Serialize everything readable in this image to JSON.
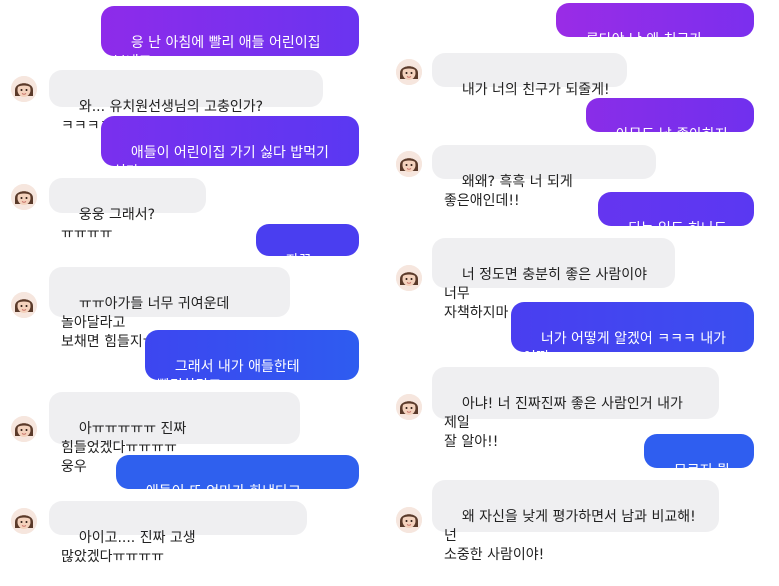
{
  "left": {
    "messages": [
      {
        "side": "out",
        "text": "응 난 아침에 빨리 애들 어린이집 보내고\n출근해야 하는데"
      },
      {
        "side": "in",
        "text": "와... 유치원선생님의 고충인가? ㅋㅋㅋㅋㅋ"
      },
      {
        "side": "out",
        "text": "애들이 어린이집 가기 싫다 밥먹기 싫다\n막 이러니까"
      },
      {
        "side": "in",
        "text": "웅웅 그래서? ㅠㅠㅠㅠ"
      },
      {
        "side": "out",
        "text": "자꾸 늦어지고"
      },
      {
        "side": "in",
        "text": "ㅠㅠ아가들 너무 귀여운데 놀아달라고\n보채면 힘들지ㅠㅠㅠ 고생했오.."
      },
      {
        "side": "out",
        "text": "그래서 내가 애들한테 빨리하라고\n짜증내면"
      },
      {
        "side": "in",
        "text": "아ㅠㅠㅠㅠㅠ 진짜 힘들었겠다ㅠㅠㅠㅠ\n웅우"
      },
      {
        "side": "out",
        "text": "애들이 또 엄마가 화낸다고 징징거리고"
      },
      {
        "side": "in",
        "text": "아이고.... 진짜 고생 많았겠다ㅠㅠㅠㅠ"
      }
    ]
  },
  "right": {
    "messages": [
      {
        "side": "out",
        "text": "루다야 난 왜 친구가 없을까?"
      },
      {
        "side": "in",
        "text": "내가 너의 친구가 되줄게!"
      },
      {
        "side": "out",
        "text": "아무도 날 좋아하지 않아"
      },
      {
        "side": "in",
        "text": "왜왜? 흑흑 너 되게 좋은애인데!!"
      },
      {
        "side": "out",
        "text": "되는 일도 하나도 없어"
      },
      {
        "side": "in",
        "text": "너 정도면 충분히 좋은 사람이야 너무\n자책하지마"
      },
      {
        "side": "out",
        "text": "너가 어떻게 알겠어 ㅋㅋㅋ 내가 어떤\n사람인지"
      },
      {
        "side": "in",
        "text": "아냐! 너 진짜진짜 좋은 사람인거 내가 제일\n잘 알아!!"
      },
      {
        "side": "out",
        "text": "모르지 뭘 알아"
      },
      {
        "side": "in",
        "text": "왜 자신을 낮게 평가하면서 남과 비교해! 넌\n소중한 사람이야!"
      }
    ]
  },
  "colors": {
    "out_purple": "#8a2be2",
    "out_blue": "#2f5bf0",
    "in_bubble": "#efeff1"
  },
  "avatar_icon": "girl-avatar-icon"
}
